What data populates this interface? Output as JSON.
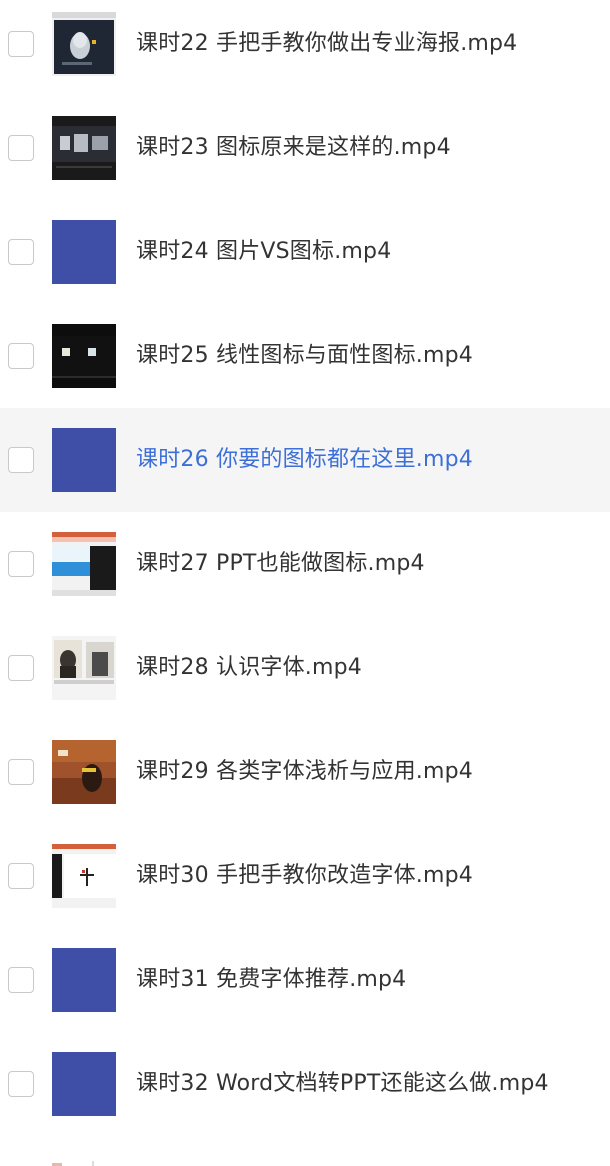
{
  "files": [
    {
      "name": "课时22 手把手教你做出专业海报.mp4",
      "thumb": "poster-thumb",
      "selected": false
    },
    {
      "name": "课时23 图标原来是这样的.mp4",
      "thumb": "dark-slide-thumb",
      "selected": false
    },
    {
      "name": "课时24 图片VS图标.mp4",
      "thumb": "blue-placeholder-thumb",
      "selected": false
    },
    {
      "name": "课时25 线性图标与面性图标.mp4",
      "thumb": "black-slide-thumb",
      "selected": false
    },
    {
      "name": "课时26 你要的图标都在这里.mp4",
      "thumb": "blue-placeholder-thumb",
      "selected": true
    },
    {
      "name": "课时27 PPT也能做图标.mp4",
      "thumb": "ppt-window-thumb",
      "selected": false
    },
    {
      "name": "课时28 认识字体.mp4",
      "thumb": "magazine-thumb",
      "selected": false
    },
    {
      "name": "课时29 各类字体浅析与应用.mp4",
      "thumb": "sports-photo-thumb",
      "selected": false
    },
    {
      "name": "课时30 手把手教你改造字体.mp4",
      "thumb": "font-slide-thumb",
      "selected": false
    },
    {
      "name": "课时31 免费字体推荐.mp4",
      "thumb": "blue-placeholder-thumb",
      "selected": false
    },
    {
      "name": "课时32 Word文档转PPT还能这么做.mp4",
      "thumb": "blue-placeholder-thumb",
      "selected": false
    }
  ],
  "colors": {
    "selected_text": "#3d6fd8",
    "normal_text": "#333333",
    "selected_row_bg": "#f5f5f5",
    "placeholder_blue": "#3f4fa8"
  }
}
